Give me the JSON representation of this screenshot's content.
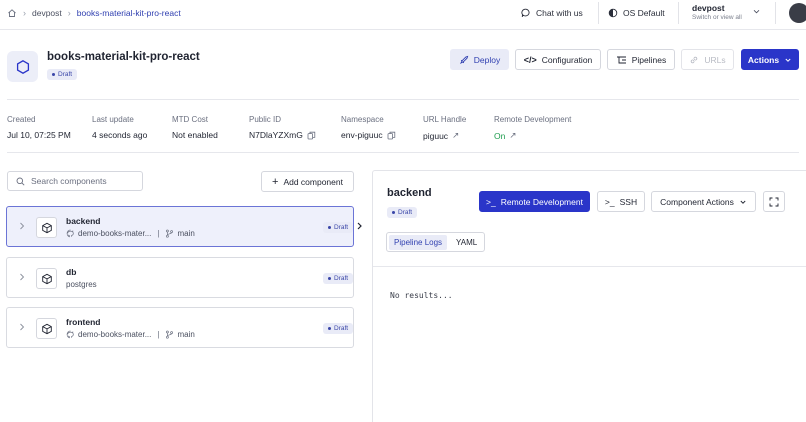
{
  "breadcrumb": {
    "items": [
      "devpost",
      "books-material-kit-pro-react"
    ]
  },
  "topbar": {
    "chat_label": "Chat with us",
    "theme_label": "OS Default"
  },
  "account": {
    "name": "devpost",
    "subtitle": "Switch or view all"
  },
  "header": {
    "title": "books-material-kit-pro-react",
    "status": "Draft",
    "buttons": {
      "deploy": "Deploy",
      "configuration": "Configuration",
      "pipelines": "Pipelines",
      "urls": "URLs",
      "actions": "Actions"
    }
  },
  "meta": [
    {
      "label": "Created",
      "value": "Jul 10, 07:25 PM"
    },
    {
      "label": "Last update",
      "value": "4 seconds ago"
    },
    {
      "label": "MTD Cost",
      "value": "Not enabled"
    },
    {
      "label": "Public ID",
      "value": "N7DlaYZXmG"
    },
    {
      "label": "Namespace",
      "value": "env-piguuc"
    },
    {
      "label": "URL Handle",
      "value": "piguuc"
    },
    {
      "label": "Remote Development",
      "value": "On"
    }
  ],
  "components": {
    "search_placeholder": "Search  components",
    "add_label": "Add component",
    "items": [
      {
        "name": "backend",
        "repo": "demo-books-mater...",
        "branch": "main",
        "status": "Draft"
      },
      {
        "name": "db",
        "repo": "postgres",
        "status": "Draft"
      },
      {
        "name": "frontend",
        "repo": "demo-books-mater...",
        "branch": "main",
        "status": "Draft"
      }
    ]
  },
  "detail": {
    "name": "backend",
    "status": "Draft",
    "remote_dev_label": "Remote Development",
    "ssh_label": "SSH",
    "component_actions_label": "Component Actions",
    "tabs": [
      "Pipeline Logs",
      "YAML"
    ],
    "logs_text": "No results..."
  },
  "colors": {
    "accent": "#2a35c9",
    "badge_bg": "#e9ebf7",
    "success": "#1f9d4f"
  }
}
